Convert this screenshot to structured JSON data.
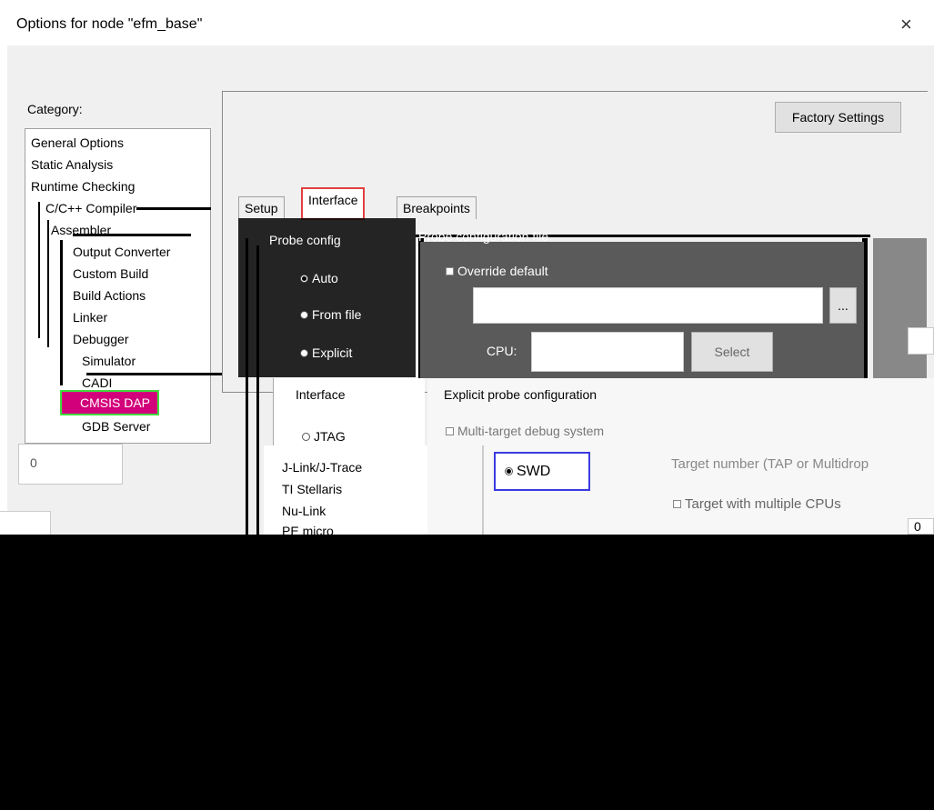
{
  "dialog": {
    "title": "Options for node \"efm_base\"",
    "close_glyph": "×"
  },
  "category": {
    "label": "Category:",
    "items": [
      {
        "label": "General Options"
      },
      {
        "label": "Static Analysis"
      },
      {
        "label": "Runtime Checking"
      },
      {
        "label": "C/C++ Compiler"
      },
      {
        "label": "Assembler"
      },
      {
        "label": "Output Converter"
      },
      {
        "label": "Custom Build"
      },
      {
        "label": "Build Actions"
      },
      {
        "label": "Linker"
      },
      {
        "label": "Debugger"
      },
      {
        "label": "Simulator"
      },
      {
        "label": "CADI"
      },
      {
        "label": "CMSIS DAP",
        "selected": true
      },
      {
        "label": "GDB Server"
      }
    ]
  },
  "toolbar": {
    "factory_settings_label": "Factory Settings"
  },
  "tabs": [
    {
      "label": "Setup"
    },
    {
      "label": "Interface",
      "active": true
    },
    {
      "label": "Breakpoints"
    }
  ],
  "probe_config": {
    "group_label": "Probe config",
    "options": [
      {
        "label": "Auto",
        "checked": true
      },
      {
        "label": "From file",
        "checked": false
      },
      {
        "label": "Explicit",
        "checked": false
      }
    ]
  },
  "probe_config_file": {
    "group_label": "Probe configuration file",
    "override_label": "Override default",
    "path_value": "",
    "browse_label": "...",
    "cpu_label": "CPU:",
    "select_label": "Select"
  },
  "interface": {
    "group_label": "Interface",
    "options": [
      {
        "label": "JTAG",
        "checked": false
      },
      {
        "label": "SWD",
        "checked": true
      }
    ]
  },
  "explicit_probe": {
    "group_label": "Explicit probe configuration",
    "multi_target_label": "Multi-target debug system",
    "target_number_label": "Target number (TAP or Multidrop",
    "multiple_cpus_label": "Target with multiple CPUs",
    "cpu_number_value": "0"
  },
  "left_numeric_value": "0",
  "driver_list": [
    "J-Link/J-Trace",
    "TI Stellaris",
    "Nu-Link",
    "PE micro"
  ],
  "colors": {
    "selected_item_bg": "#d2007a",
    "highlight_green": "#3fdc3f",
    "highlight_red": "#e04040",
    "highlight_blue": "#3a3ae0"
  }
}
